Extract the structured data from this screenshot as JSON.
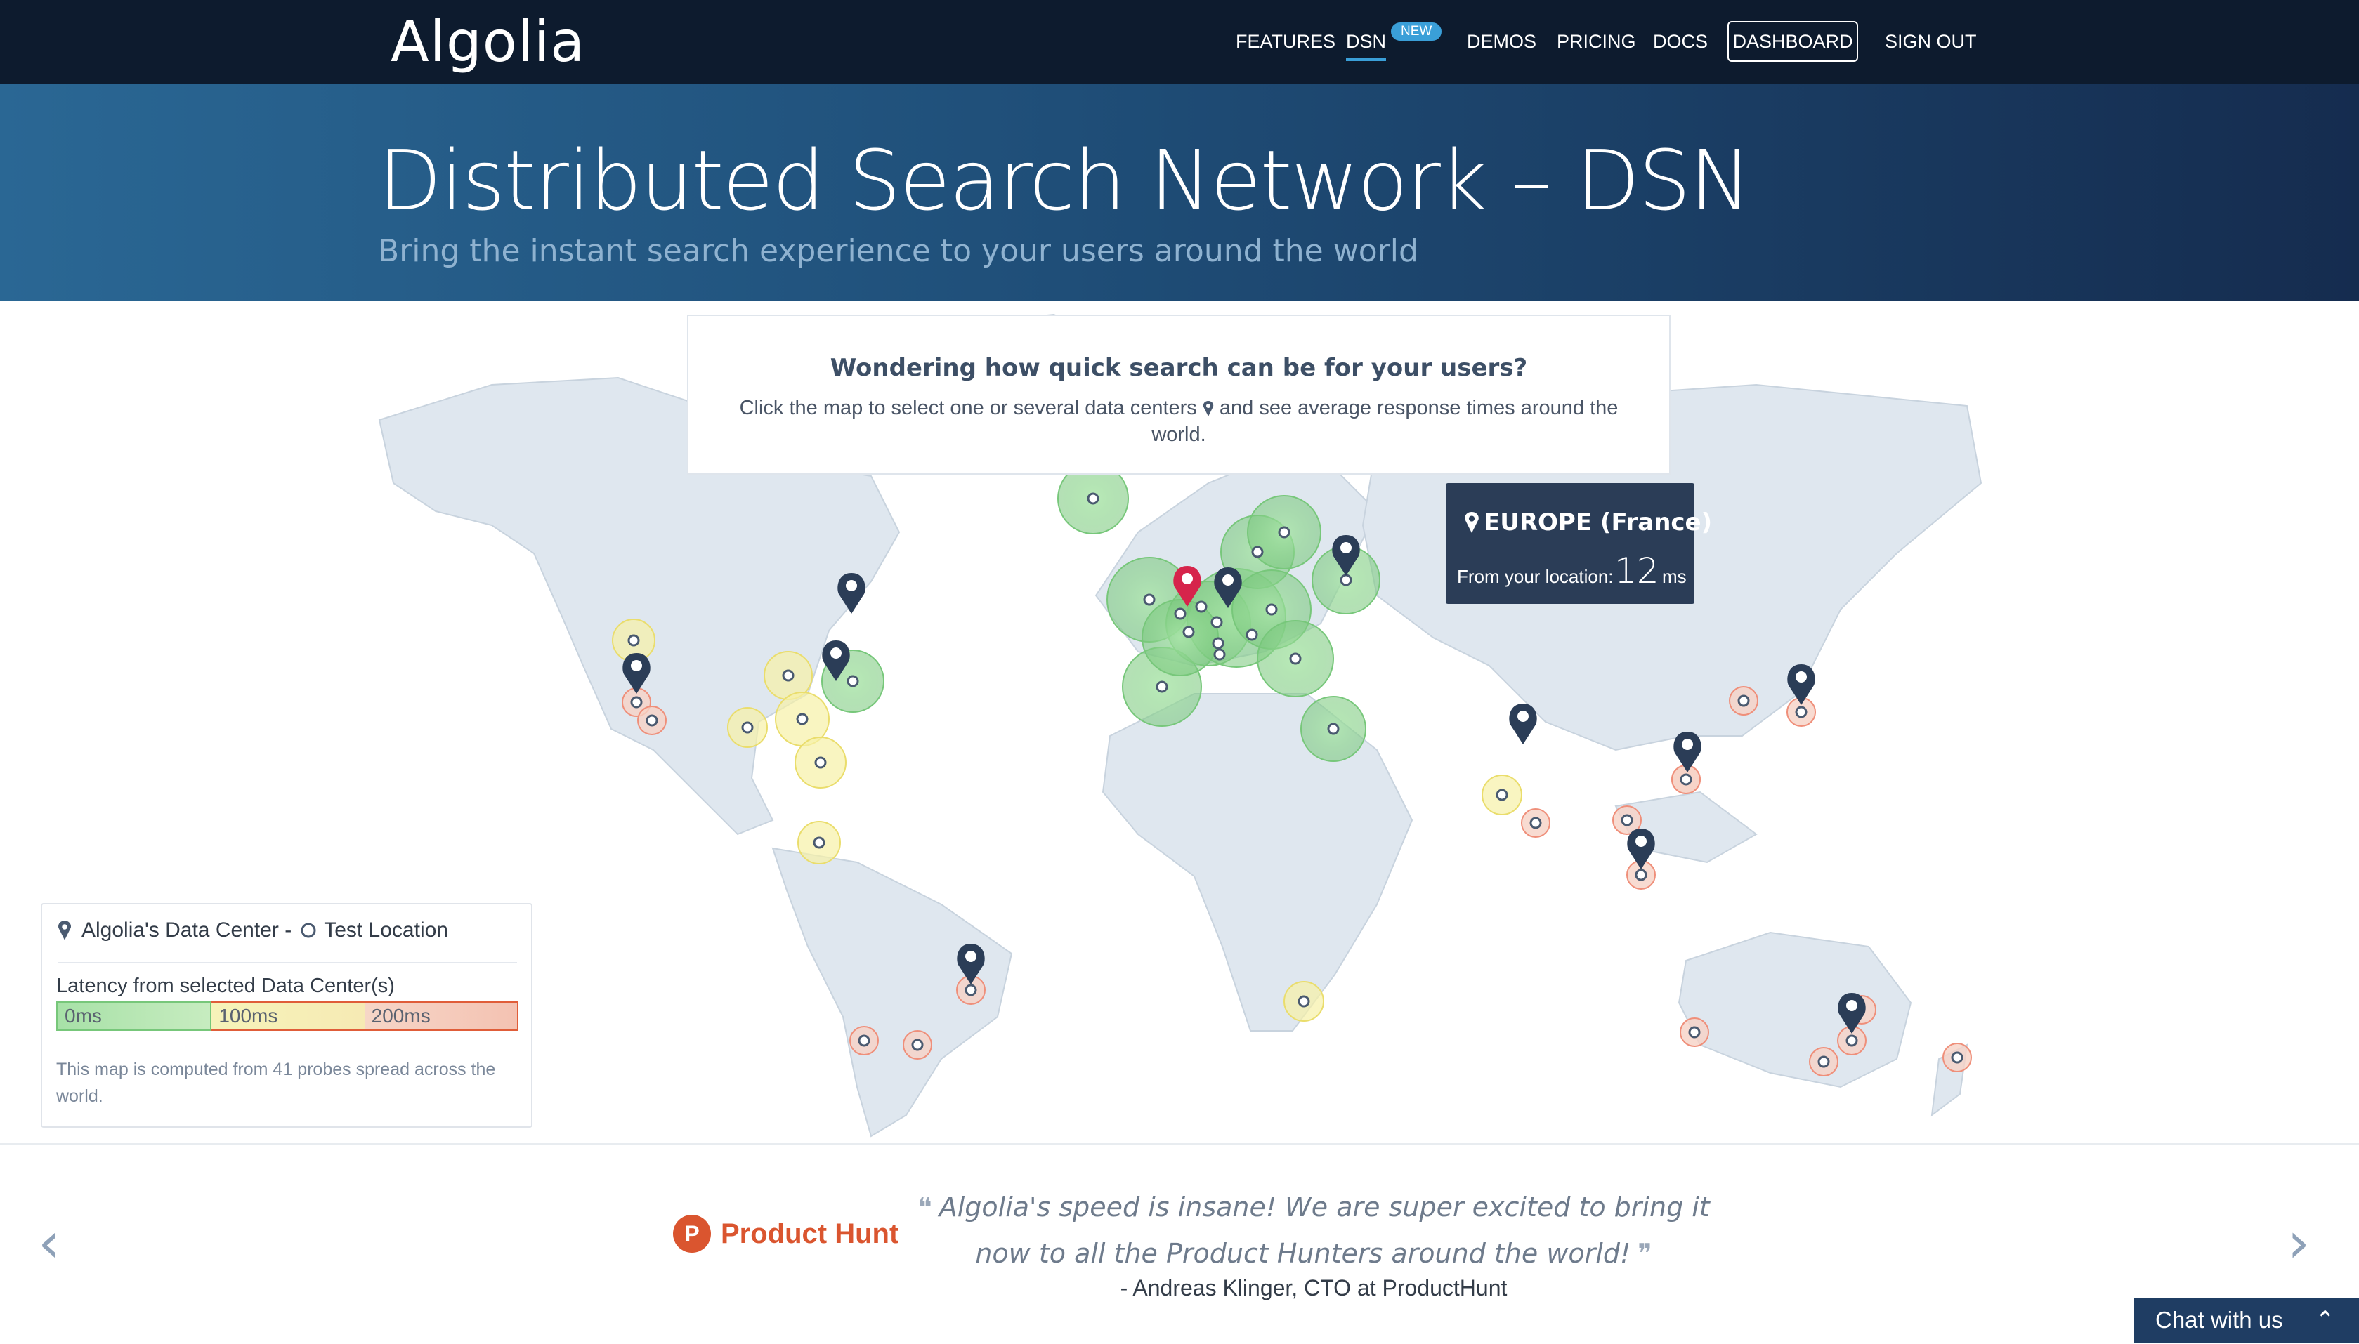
{
  "nav": {
    "logo": "Algolia",
    "items": [
      {
        "label": "FEATURES"
      },
      {
        "label": "DSN"
      },
      {
        "label": "DEMOS"
      },
      {
        "label": "PRICING"
      },
      {
        "label": "DOCS"
      }
    ],
    "new_badge": "NEW",
    "dashboard": "DASHBOARD",
    "signout": "SIGN OUT"
  },
  "hero": {
    "title": "Distributed Search Network – DSN",
    "subtitle": "Bring the instant search experience to your users around the world"
  },
  "info": {
    "title": "Wondering how quick search can be for your users?",
    "text_before": "Click the map to select one or several data centers",
    "text_after": "and see average response times around the world."
  },
  "tooltip": {
    "title": "EUROPE (France)",
    "label": "From your location:",
    "value": "12",
    "unit": "ms"
  },
  "legend": {
    "dc_label": "Algolia's Data Center -",
    "test_label": "Test Location",
    "latency_label": "Latency from selected Data Center(s)",
    "scale": [
      "0ms",
      "100ms",
      "200ms"
    ],
    "note": "This map is computed from 41 probes spread across the world."
  },
  "testimonial": {
    "brand": "Product Hunt",
    "brand_initial": "P",
    "quote": "Algolia's speed is insane! We are super excited to bring it now to all the Product Hunters around the world!",
    "author": "- Andreas Klinger, CTO at ProductHunt"
  },
  "chat": {
    "label": "Chat with us"
  },
  "colors": {
    "nav_bg": "#0d1b2e",
    "accent": "#3a9fd8",
    "selected_pin": "#d6244b",
    "pin": "#2b3d57",
    "green": "#77c77a",
    "yellow": "#f0e27a",
    "red": "#ef8f7a"
  }
}
